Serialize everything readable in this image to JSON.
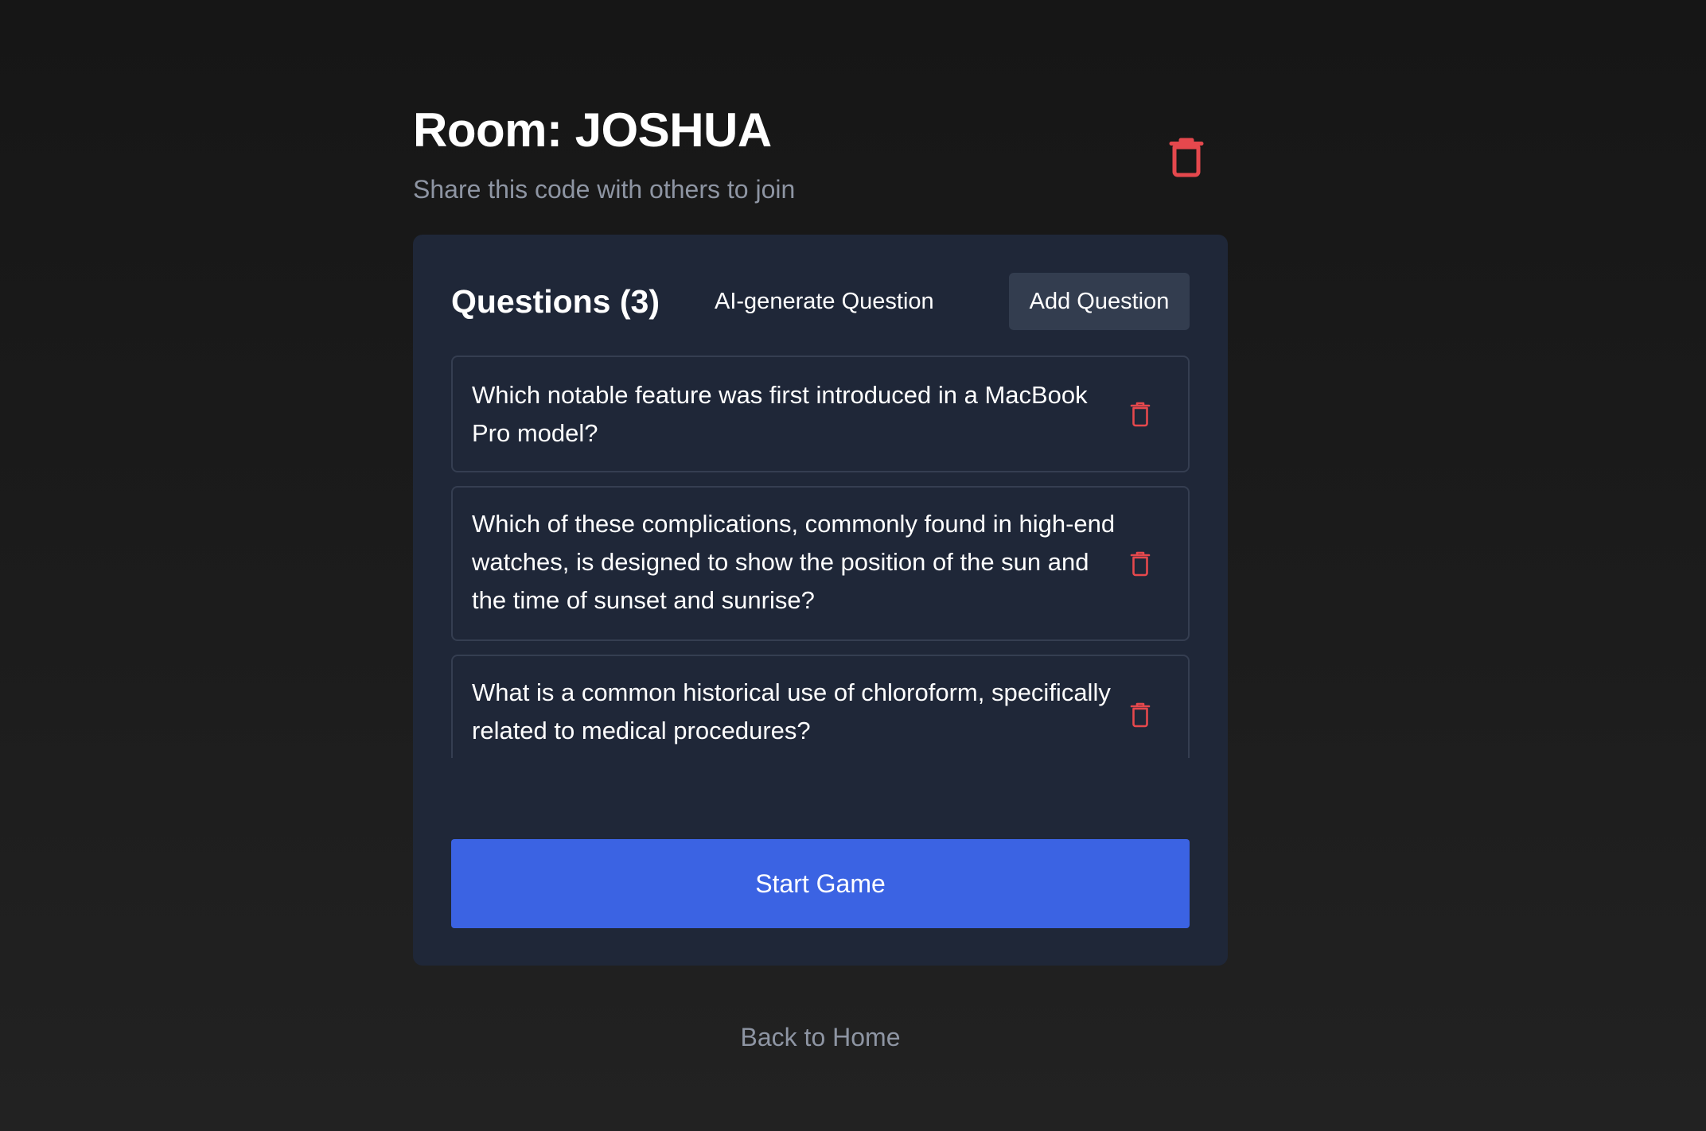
{
  "room": {
    "title": "Room: JOSHUA",
    "subtitle": "Share this code with others to join",
    "delete_icon": "trash-icon"
  },
  "questions_panel": {
    "title": "Questions (3)",
    "ai_generate_label": "AI-generate Question",
    "add_label": "Add Question",
    "items": [
      {
        "text": "Which notable feature was first introduced in a MacBook Pro model?"
      },
      {
        "text": "Which of these complications, commonly found in high-end watches, is designed to show the position of the sun and the time of sunset and sunrise?"
      },
      {
        "text": "What is a common historical use of chloroform, specifically related to medical procedures?"
      }
    ]
  },
  "start_label": "Start Game",
  "back_label": "Back to Home",
  "colors": {
    "background": "#1c1c1c",
    "card": "#1f2738",
    "accent": "#3b63e3",
    "danger": "#e5484d",
    "muted_text": "#8e95a3"
  }
}
